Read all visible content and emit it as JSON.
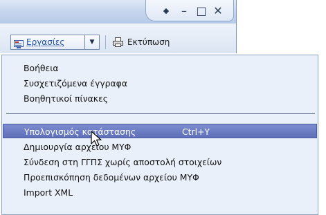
{
  "window": {
    "controls": [
      "◆",
      "–",
      "□",
      "✕"
    ]
  },
  "toolbar": {
    "work_label": "Εργασίες",
    "print_label": "Εκτύπωση"
  },
  "menu": {
    "group1": [
      "Βοήθεια",
      "Συσχετιζόμενα έγγραφα",
      "Βοηθητικοί πίνακες"
    ],
    "highlighted": {
      "label": "Υπολογισμός κατάστασης",
      "shortcut": "Ctrl+Y"
    },
    "group2": [
      "Δημιουργία αρχείου ΜΥΦ",
      "Σύνδεση στη ΓΓΠΣ χωρίς αποστολή στοιχείων",
      "Προεπισκόπηση δεδομένων αρχείου ΜΥΦ",
      "Import XML"
    ]
  },
  "colors": {
    "highlight": "#6a7bc4",
    "menu_bg": "#eaf0fa"
  }
}
